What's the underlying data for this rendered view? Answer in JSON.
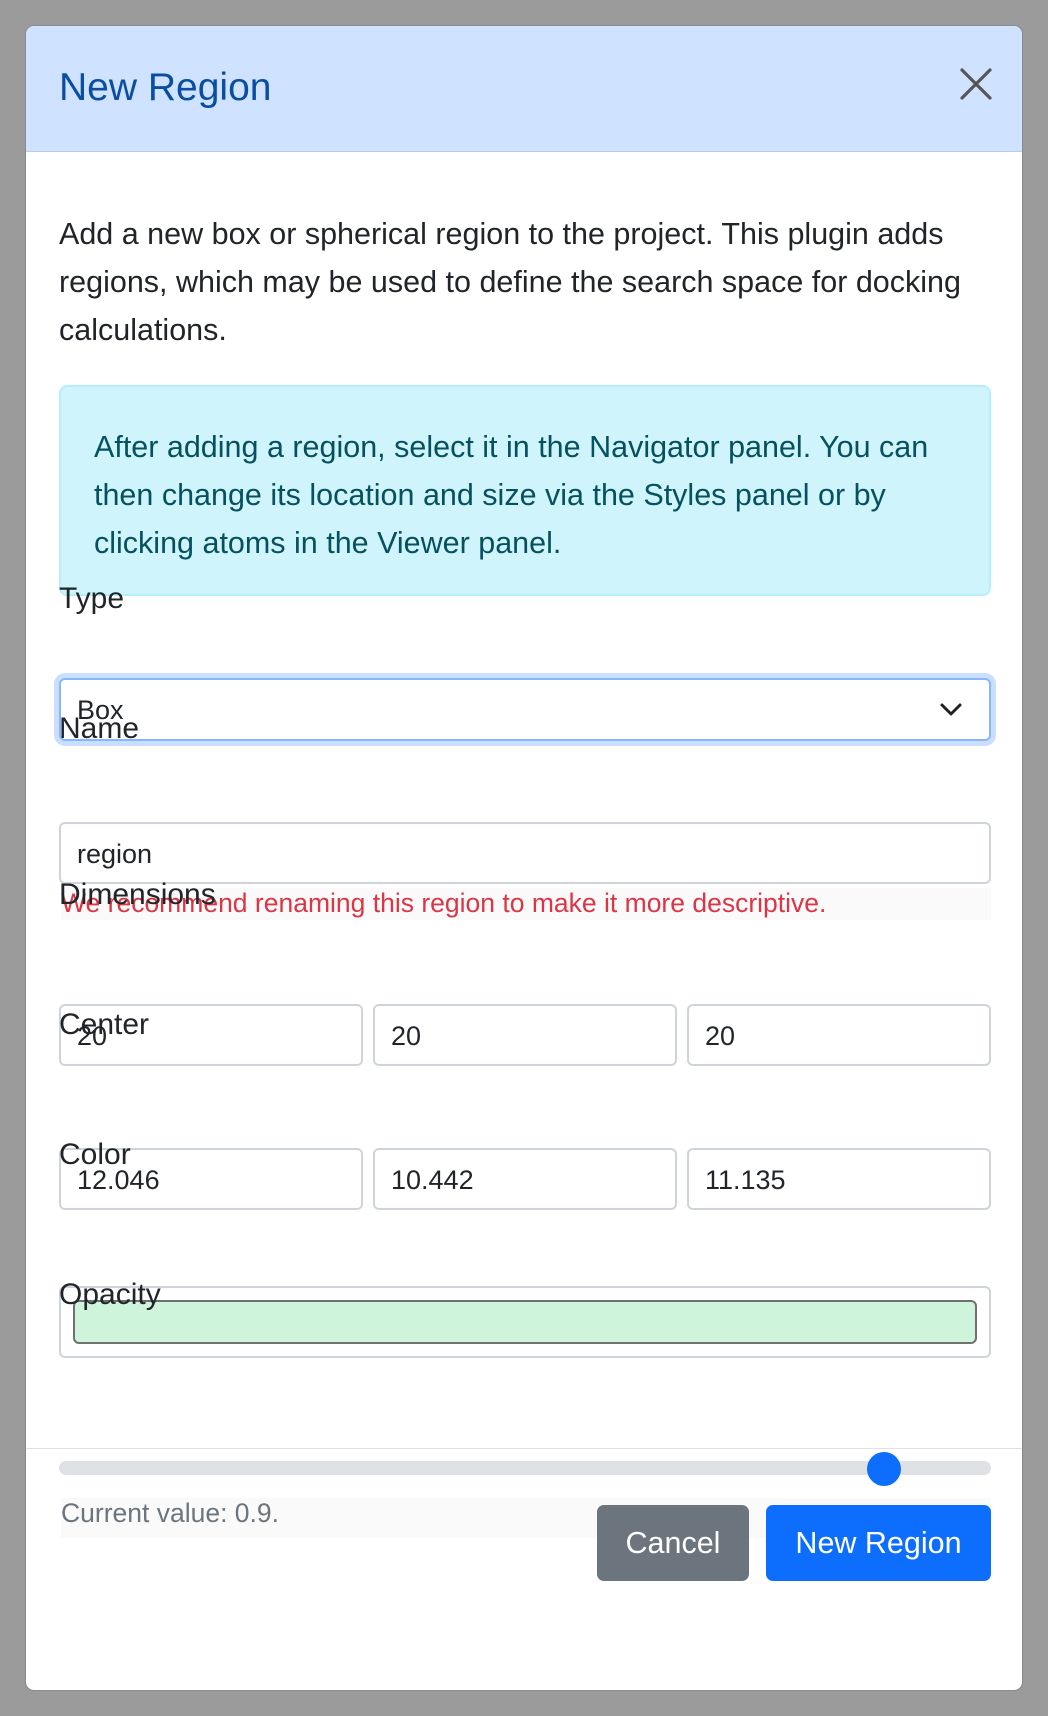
{
  "modal": {
    "title": "New Region",
    "intro": "Add a new box or spherical region to the project. This plugin adds regions, which may be used to define the search space for docking calculations.",
    "alert": "After adding a region, select it in the Navigator panel. You can then change its location and size via the Styles panel or by clicking atoms in the Viewer panel."
  },
  "form": {
    "type_label": "Type",
    "type_value": "Box",
    "name_label": "Name",
    "name_value": "region",
    "name_warning": "We recommend renaming this region to make it more descriptive.",
    "dimensions_label": "Dimensions",
    "dimensions": [
      "20",
      "20",
      "20"
    ],
    "center_label": "Center",
    "center": [
      "12.046",
      "10.442",
      "11.135"
    ],
    "color_label": "Color",
    "color_value": "#cff4dc",
    "opacity_label": "Opacity",
    "opacity_value": 0.9,
    "opacity_help": "Current value: 0.9."
  },
  "footer": {
    "cancel_label": "Cancel",
    "submit_label": "New Region"
  },
  "icons": {
    "close": "close-icon",
    "dropdown": "chevron-down-icon"
  },
  "colors": {
    "header_bg": "#cfe2ff",
    "title": "#0a4ea3",
    "alert_bg": "#cff4fc",
    "alert_text": "#055160",
    "warning_text": "#dc3545",
    "primary": "#0d6efd",
    "secondary": "#6c757d"
  }
}
